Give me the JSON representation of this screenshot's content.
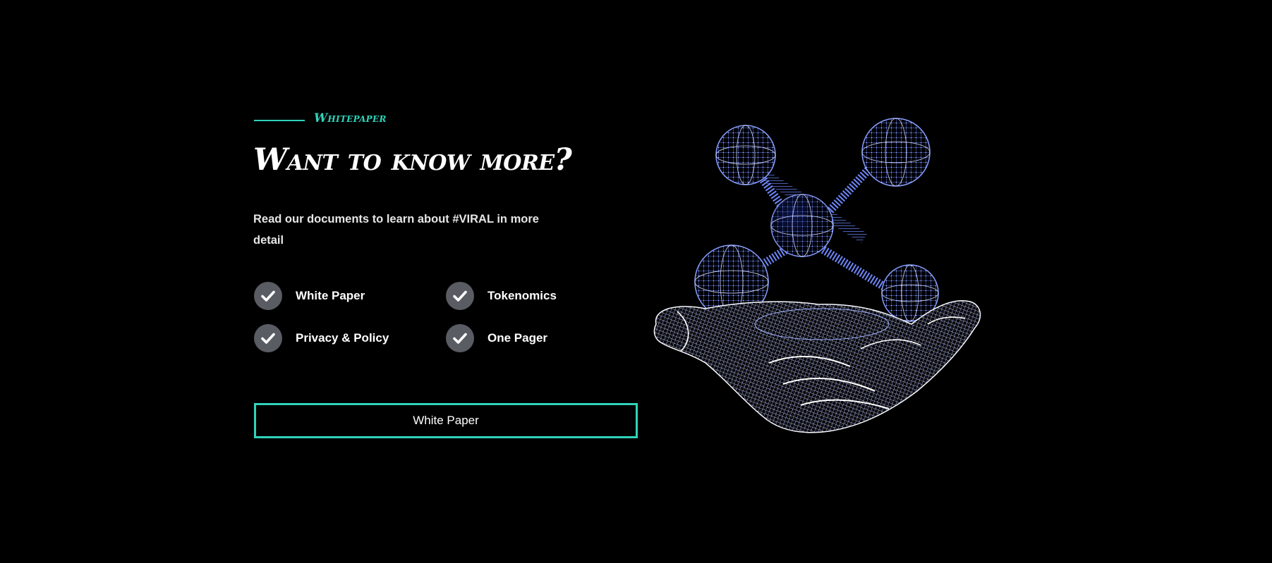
{
  "section": {
    "eyebrow": "Whitepaper",
    "headline": "Want to know more?",
    "description": "Read our documents to learn about #VIRAL in more detail",
    "features": [
      {
        "label": "White Paper",
        "icon": "check-icon"
      },
      {
        "label": "Tokenomics",
        "icon": "check-icon"
      },
      {
        "label": "Privacy & Policy",
        "icon": "check-icon"
      },
      {
        "label": "One Pager",
        "icon": "check-icon"
      }
    ],
    "cta_label": "White Paper"
  },
  "illustration": {
    "icon": "wireframe-hand-molecule-icon"
  },
  "colors": {
    "background": "#000000",
    "accent": "#2fd3bb",
    "check_bg": "#5a5c63",
    "wire_blue": "#5b78ff",
    "wire_white": "#ffffff"
  }
}
